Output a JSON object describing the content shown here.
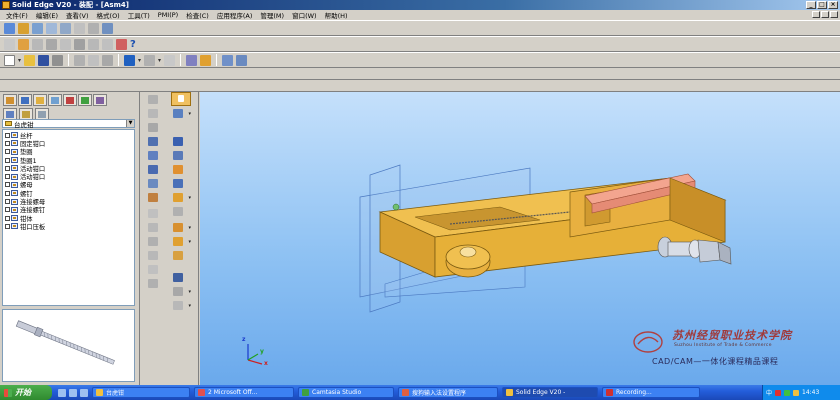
{
  "window": {
    "title": "Solid Edge V20 - 装配 - [Asm4]"
  },
  "menu": [
    "文件(F)",
    "编辑(E)",
    "查看(V)",
    "格式(O)",
    "工具(T)",
    "PMI(P)",
    "检查(C)",
    "应用程序(A)",
    "管理(M)",
    "窗口(W)",
    "帮助(H)"
  ],
  "toolbar": {
    "help_glyph": "?"
  },
  "assembly": {
    "selector_value": "台虎钳",
    "parts": [
      "丝杆",
      "固定钳口",
      "垫圈",
      "垫圈1",
      "活动钳口",
      "活动钳口",
      "螺母",
      "螺钉",
      "连接螺母",
      "连接螺钉",
      "钳体",
      "钳口压板"
    ]
  },
  "watermark": {
    "school_cn": "苏州经贸职业技术学院",
    "school_en": "Suzhou Institute of Trade & Commerce",
    "course": "CAD/CAM—一体化课程精品课程"
  },
  "axes": {
    "x": "x",
    "y": "y",
    "z": "z"
  },
  "taskbar": {
    "start": "开始",
    "tasks": [
      "台虎钳",
      "2 Microsoft Off...",
      "Camtasia Studio",
      "搜狗输入法设置程序",
      "Solid Edge V20 -",
      "Recording..."
    ],
    "active_index": 4,
    "tray_lang": "中",
    "clock": "14:43"
  },
  "colors": {
    "part_gold": "#e8b030",
    "jaw_plate": "#f0a090",
    "viewport_top": "#c5e0fb",
    "viewport_bottom": "#6aa9ec"
  }
}
